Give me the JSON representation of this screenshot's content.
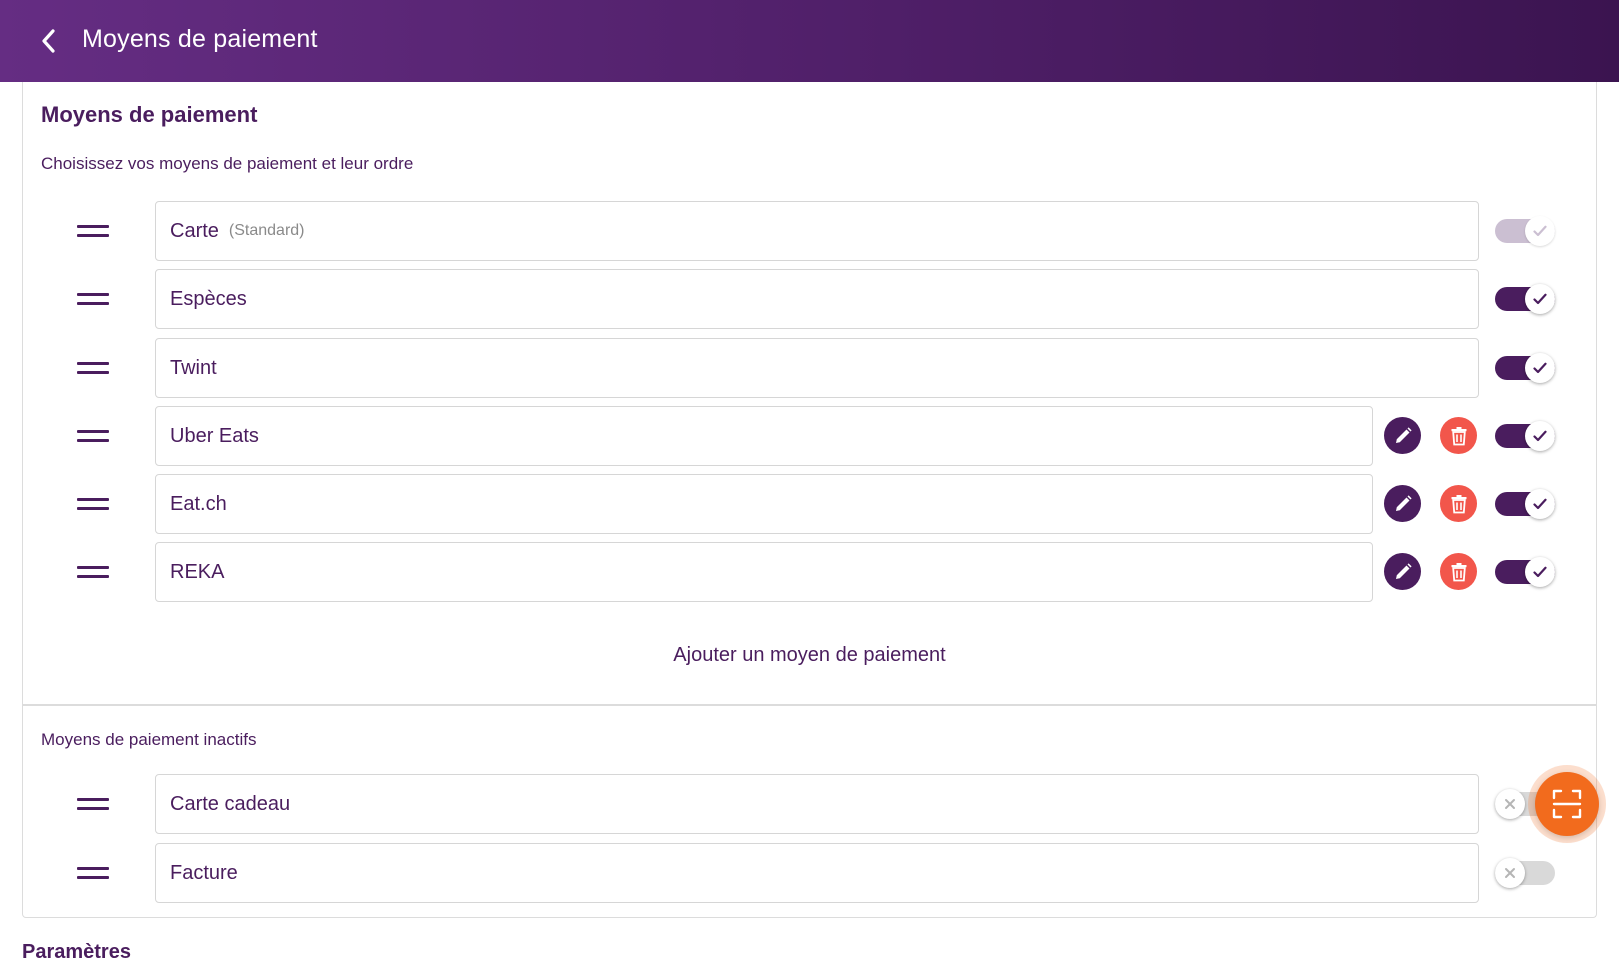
{
  "header": {
    "title": "Moyens de paiement",
    "back_icon": "chevron-left-icon"
  },
  "active_section": {
    "title": "Moyens de paiement",
    "subtitle": "Choisissez vos moyens de paiement et leur ordre",
    "items": [
      {
        "name": "Carte",
        "note": "(Standard)",
        "enabled": true,
        "locked": true,
        "editable": false
      },
      {
        "name": "Espèces",
        "enabled": true,
        "editable": false
      },
      {
        "name": "Twint",
        "enabled": true,
        "editable": false
      },
      {
        "name": "Uber Eats",
        "enabled": true,
        "editable": true
      },
      {
        "name": "Eat.ch",
        "enabled": true,
        "editable": true
      },
      {
        "name": "REKA",
        "enabled": true,
        "editable": true
      }
    ],
    "add_label": "Ajouter un moyen de paiement"
  },
  "inactive_section": {
    "title": "Moyens de paiement inactifs",
    "items": [
      {
        "name": "Carte cadeau",
        "enabled": false
      },
      {
        "name": "Facture",
        "enabled": false
      }
    ]
  },
  "params_title": "Paramètres",
  "fab": {
    "icon": "scan-icon"
  },
  "colors": {
    "primary": "#4a1d5e",
    "header_start": "#652d83",
    "header_end": "#3b1450",
    "danger": "#f2564b",
    "accent": "#f26b1d"
  }
}
